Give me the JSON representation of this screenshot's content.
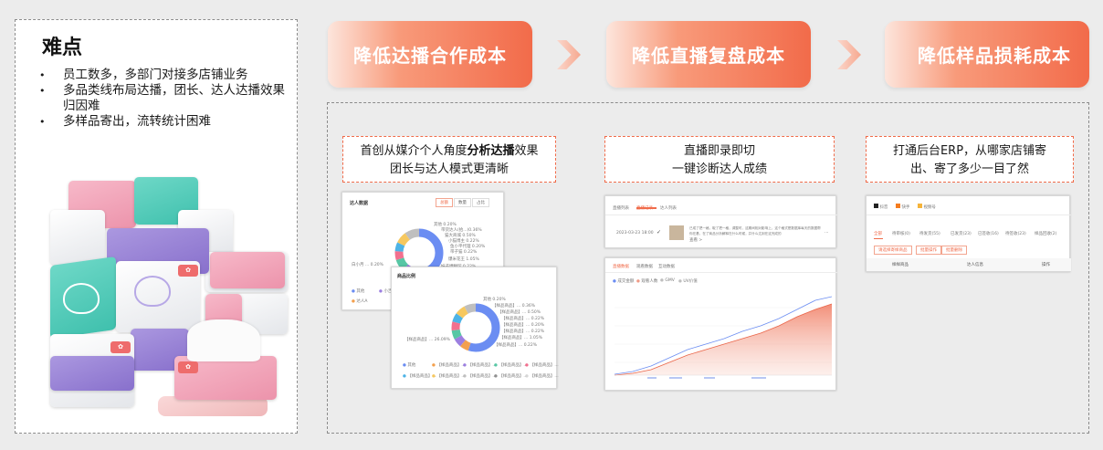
{
  "pain": {
    "title": "难点",
    "items": [
      "员工数多，多部门对接多店铺业务",
      "多品类线布局达播，团长、达人达播效果归因难",
      "多样品寄出，流转统计困难"
    ]
  },
  "steps": [
    "降低达播合作成本",
    "降低直播复盘成本",
    "降低样品损耗成本"
  ],
  "captions": {
    "c1_line1_pre": "首创从媒介个人角度",
    "c1_line1_bold": "分析达播",
    "c1_line1_post": "效果",
    "c1_line2": "团长与达人模式更清晰",
    "c2_line1": "直播即录即切",
    "c2_line2": "一键诊断达人成绩",
    "c3_line1": "打通后台ERP，从哪家店铺寄",
    "c3_line2": "出、寄了多少一目了然"
  },
  "shot1": {
    "title": "达人数据",
    "tabs": [
      "总额",
      "数量",
      "占比"
    ],
    "labels": [
      "其他 0.20%",
      "带货达人(拾...)0.36%",
      "猫大商城 0.50%",
      "小猫博主 0.22%",
      "鱼小平代理 0.20%",
      "带子猫 0.22%",
      "爆米花王 1.05%",
      "妹子博物馆 0.22%"
    ],
    "center_left": "白小月 ... 0.20%",
    "legend": [
      "其他",
      "达人A",
      "小吉吉"
    ],
    "colors": [
      "#6b8df2",
      "#f3a04e",
      "#9c7fe0",
      "#57c7a5",
      "#f2708f",
      "#4db3e6",
      "#f6c85f",
      "#bfbfbf"
    ],
    "share": [
      0.5,
      0.06,
      0.06,
      0.08,
      0.06,
      0.06,
      0.08,
      0.1
    ]
  },
  "shot1b": {
    "title": "商品比例",
    "labels": [
      "其他 0.20%",
      "【样品商品】... 0.36%",
      "【样品商品】... 0.50%",
      "【样品商品】... 0.22%",
      "【样品商品】... 0.20%",
      "【样品商品】... 0.22%",
      "【样品商品】... 1.05%",
      "【样品商品】... 0.22%"
    ],
    "center_left": "【样品商品】... 26.09%",
    "legend": [
      "其他",
      "【样品商品】...",
      "【样品商品】...",
      "【样品商品】...",
      "【样品商品】...",
      "【样品商品】...",
      "【样品商品】...",
      "【样品商品】...",
      "【样品商品】...",
      "【样品商品】..."
    ],
    "colors": [
      "#6b8df2",
      "#f3a04e",
      "#9c7fe0",
      "#57c7a5",
      "#f2708f",
      "#4db3e6",
      "#f6c85f",
      "#bfbfbf"
    ],
    "share": [
      0.55,
      0.06,
      0.06,
      0.06,
      0.06,
      0.06,
      0.07,
      0.08
    ]
  },
  "shot2": {
    "tabs": [
      "直播列表",
      "直播记录",
      "达人列表"
    ],
    "row_date": "2023-03-23 18:00",
    "row_text": "已成了把一格，取了把一格，调整时，这期间相对影响上，这个格式是数据库每天的数据帮你在基，在了商品分析解释在什么时候，并什么达到在这完成的",
    "row_more": "查看 >"
  },
  "shot2b": {
    "tabs": [
      "直播数据",
      "观看数据",
      "互动数据"
    ],
    "legend": [
      "成交金额",
      "观看人数",
      "GMV",
      "UV价值"
    ]
  },
  "shot3": {
    "platforms": [
      "抖音",
      "快手",
      "视频号"
    ],
    "filters": [
      "全部",
      "待审核(0)",
      "待发货(55)",
      "已发货(23)",
      "已签收(16)",
      "待签收(23)",
      "样品回收(2)"
    ],
    "chips": [
      "请选择寄样商品",
      "批量操作",
      "批量删除"
    ],
    "columns": [
      "样样商品",
      "达人信息",
      "操作"
    ]
  }
}
